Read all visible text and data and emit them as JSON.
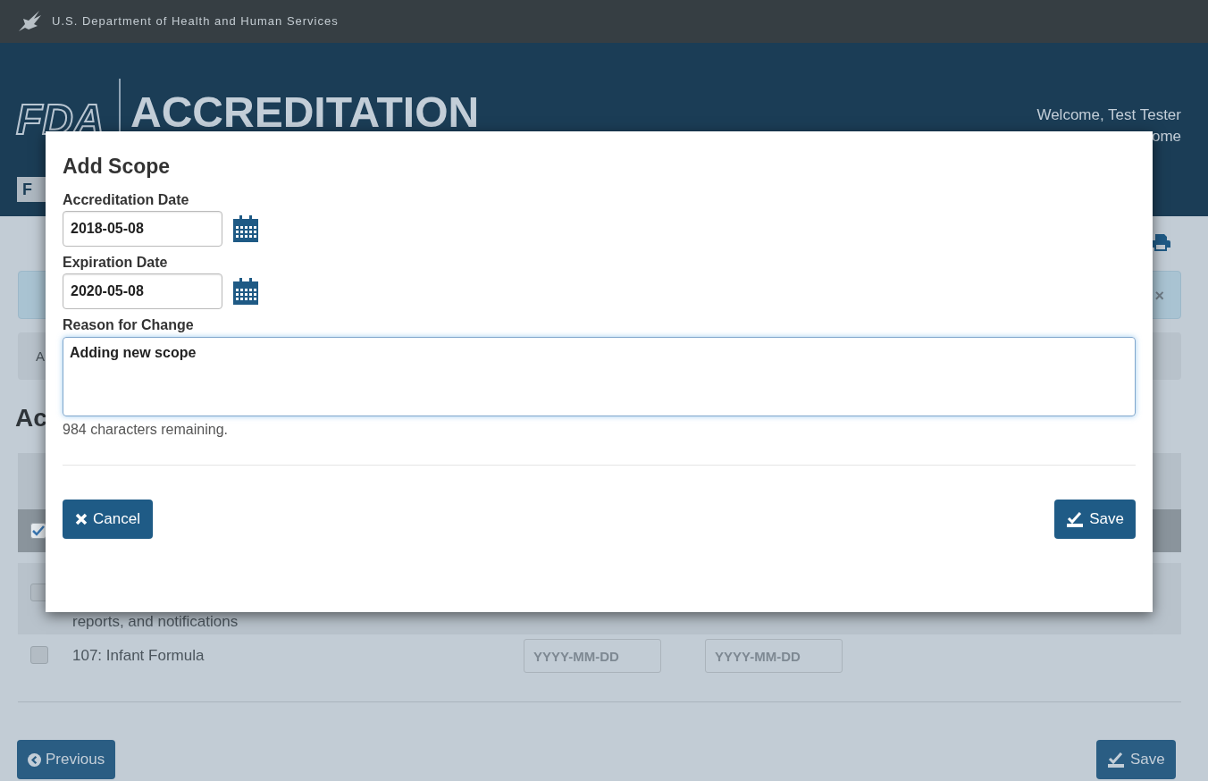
{
  "top_bar": {
    "agency": "U.S. Department of Health and Human Services"
  },
  "header": {
    "logo": "FDA",
    "logo_badge": "F",
    "title": "ACCREDITATION",
    "welcome": "Welcome, Test Tester",
    "link": "ome"
  },
  "alert": {
    "close": "×"
  },
  "nav": {
    "tab": "A"
  },
  "heading": "Ac",
  "table": {
    "select_all": {
      "checked": true
    },
    "rows": [
      {
        "checked": false,
        "label": "reports, and notifications"
      },
      {
        "checked": false,
        "label": "107: Infant Formula",
        "accreditation_placeholder": "YYYY-MM-DD",
        "expiration_placeholder": "YYYY-MM-DD"
      }
    ]
  },
  "footer_buttons": {
    "previous": "Previous",
    "save": "Save"
  },
  "modal": {
    "title": "Add Scope",
    "fields": [
      {
        "kind": "date",
        "label": "Accreditation Date",
        "value": "2018-05-08"
      },
      {
        "kind": "date",
        "label": "Expiration Date",
        "value": "2020-05-08"
      },
      {
        "kind": "textarea",
        "label": "Reason for Change",
        "value": "Adding new scope",
        "focused": true
      }
    ],
    "remaining": "984 characters remaining.",
    "buttons": {
      "cancel": "Cancel",
      "save": "Save"
    }
  }
}
